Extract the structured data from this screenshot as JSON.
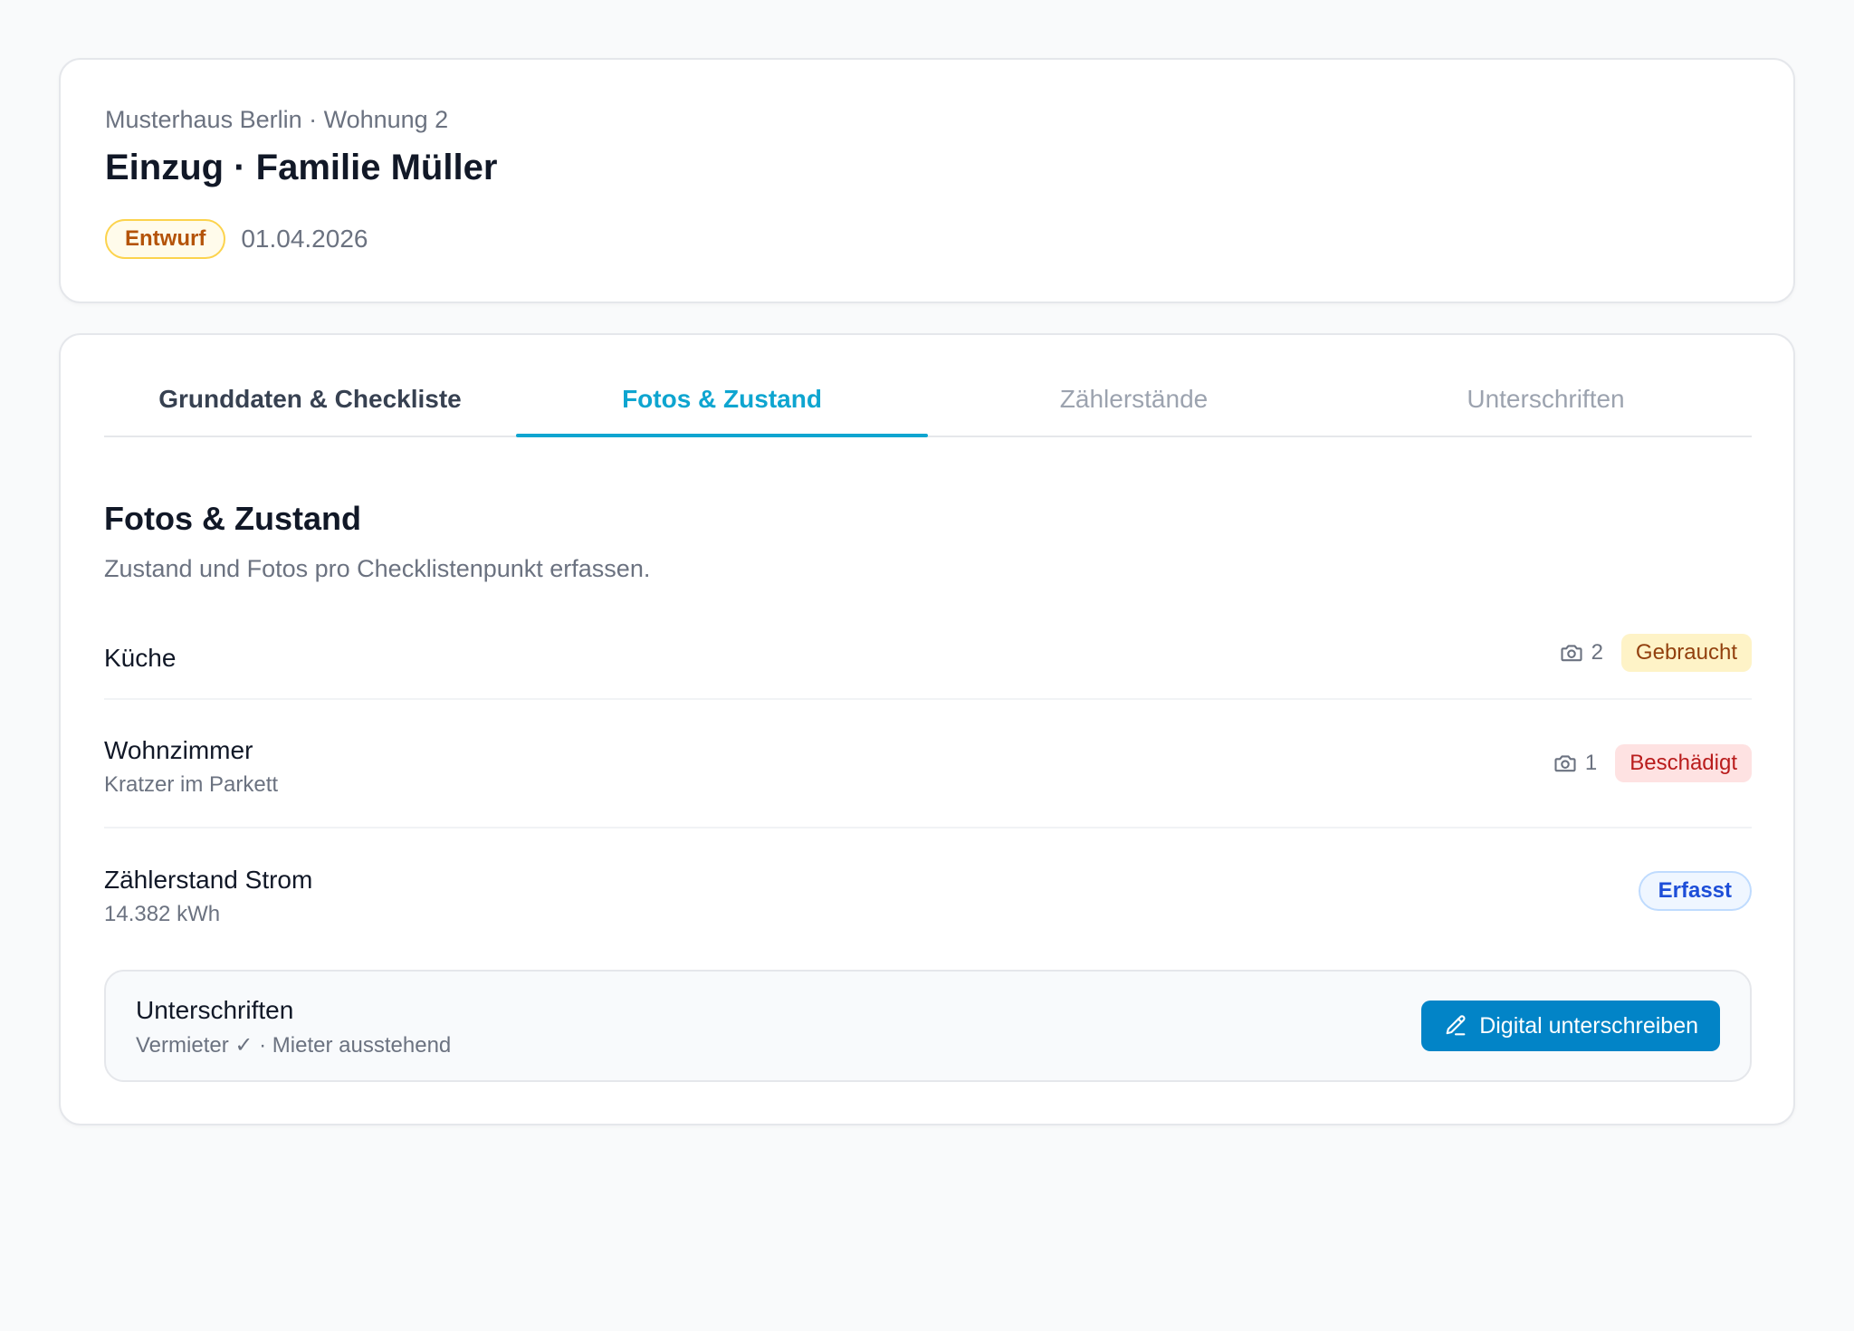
{
  "header": {
    "breadcrumb": "Musterhaus Berlin · Wohnung 2",
    "title": "Einzug · Familie Müller",
    "status_badge": "Entwurf",
    "date": "01.04.2026"
  },
  "tabs": [
    {
      "label": "Grunddaten & Checkliste",
      "state": "done"
    },
    {
      "label": "Fotos & Zustand",
      "state": "active"
    },
    {
      "label": "Zählerstände",
      "state": "inactive"
    },
    {
      "label": "Unterschriften",
      "state": "inactive"
    }
  ],
  "section": {
    "title": "Fotos & Zustand",
    "subtitle": "Zustand und Fotos pro Checklistenpunkt erfassen."
  },
  "items": [
    {
      "name": "Küche",
      "note": "",
      "photo_count": "2",
      "photo_icon": "camera-icon",
      "condition": "Gebraucht",
      "condition_color": "#92400e"
    },
    {
      "name": "Wohnzimmer",
      "note": "Kratzer im Parkett",
      "photo_count": "1",
      "photo_icon": "camera-icon",
      "condition": "Beschädigt",
      "condition_color": "#b91c1c"
    },
    {
      "name": "Zählerstand Strom",
      "note": "14.382 kWh",
      "photo_count": "",
      "condition": "Erfasst",
      "condition_color": "#1d4ed8"
    }
  ],
  "signatures": {
    "title": "Unterschriften",
    "status": "Vermieter ✓ · Mieter ausstehend",
    "button_label": "Digital unterschreiben",
    "button_icon": "pen-icon"
  },
  "colors": {
    "accent": "#0ea5d0",
    "button": "#0284c7",
    "draft_badge": "#b45309"
  }
}
